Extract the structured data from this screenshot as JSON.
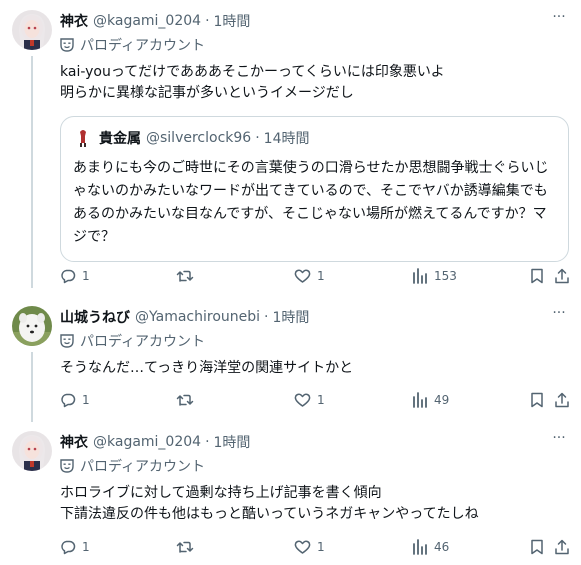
{
  "posts": [
    {
      "name": "神衣",
      "handle": "@kagami_0204",
      "time": "1時間",
      "badge": "パロディアカウント",
      "text": "kai-youってだけであああそこかーってくらいには印象悪いよ\n明らかに異様な記事が多いというイメージだし",
      "quote": {
        "name": "貴金属",
        "handle": "@silverclock96",
        "time": "14時間",
        "text": "あまりにも今のご時世にその言葉使うの口滑らせたか思想闘争戦士ぐらいじゃないのかみたいなワードが出てきているので、そこでヤバか誘導編集でもあるのかみたいな目なんですが、そこじゃない場所が燃えてるんですか？マジで？"
      },
      "replies": "1",
      "reposts": "",
      "likes": "1",
      "views": "153"
    },
    {
      "name": "山城うねび",
      "handle": "@Yamachirounebi",
      "time": "1時間",
      "badge": "パロディアカウント",
      "text": "そうなんだ…てっきり海洋堂の関連サイトかと",
      "replies": "1",
      "reposts": "",
      "likes": "1",
      "views": "49"
    },
    {
      "name": "神衣",
      "handle": "@kagami_0204",
      "time": "1時間",
      "badge": "パロディアカウント",
      "text": "ホロライブに対して過剰な持ち上げ記事を書く傾向\n下請法違反の件も他はもっと酷いっていうネガキャンやってたしね",
      "replies": "1",
      "reposts": "",
      "likes": "1",
      "views": "46"
    }
  ],
  "dot": "·",
  "more_glyph": "···",
  "icons": [
    "more-icon",
    "parody-mask-icon",
    "reply-icon",
    "repost-icon",
    "like-icon",
    "views-icon",
    "bookmark-icon",
    "share-icon"
  ],
  "colors": {
    "text": "#0f1419",
    "secondary": "#536471",
    "border": "#cfd9de"
  }
}
